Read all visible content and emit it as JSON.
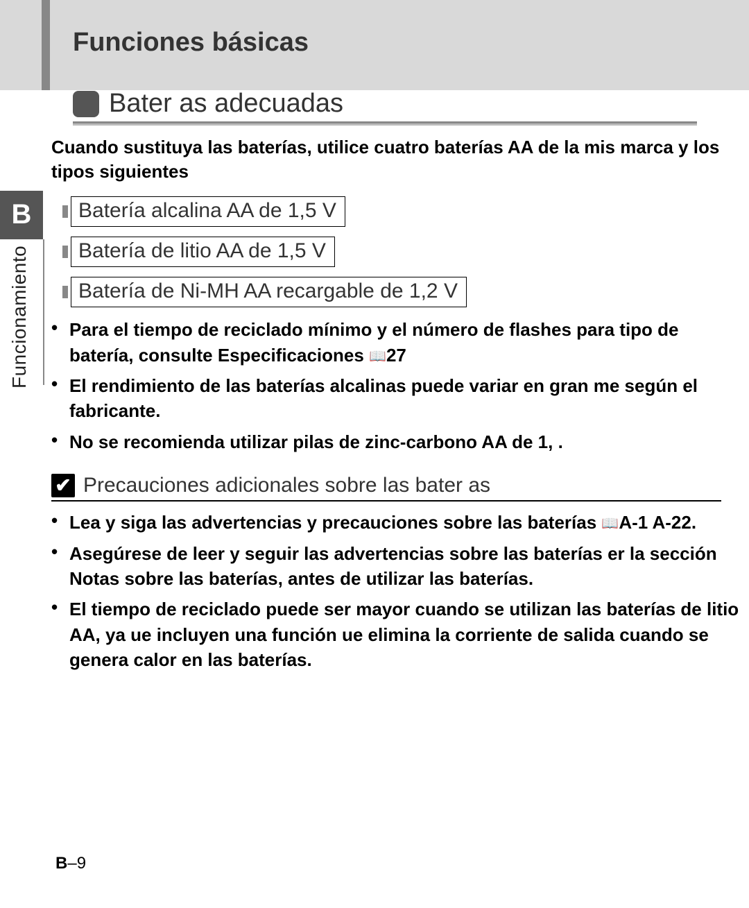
{
  "header": {
    "section_title": "Funciones básicas"
  },
  "subsection": {
    "title": "Bater as adecuadas"
  },
  "intro": "Cuando sustituya las baterías, utilice cuatro baterías AA de la mis marca y los tipos siguientes",
  "batteries": {
    "item1": "Batería alcalina AA de 1,5 V",
    "item2": "Batería de litio AA de 1,5 V",
    "item3": "Batería de Ni-MH AA recargable de 1,2 V"
  },
  "notes": {
    "b1a": "Para el tiempo de reciclado mínimo y el número de flashes para tipo de batería, consulte Especificaciones ",
    "b1b": "27",
    "b2": "El rendimiento de las baterías alcalinas puede variar en gran me según el fabricante.",
    "b3": "No se recomienda utilizar pilas de zinc-carbono AA de 1, ."
  },
  "precautions": {
    "title": "Precauciones adicionales sobre las bater as",
    "p1a": "Lea y siga las advertencias y precauciones sobre las baterías ",
    "p1b": "A-1  A-22.",
    "p2": "Asegúrese de leer y seguir las advertencias sobre las baterías er la sección Notas sobre las baterías, antes de utilizar las baterías.",
    "p3": "El tiempo de reciclado puede ser mayor cuando se utilizan las baterías de litio AA, ya ue incluyen una función ue elimina la corriente de salida cuando se genera calor en las baterías."
  },
  "side": {
    "tab": "B",
    "label": "Funcionamiento"
  },
  "page": {
    "prefix": "B",
    "num": "–9"
  },
  "icons": {
    "check": "✔",
    "book": "📖"
  }
}
